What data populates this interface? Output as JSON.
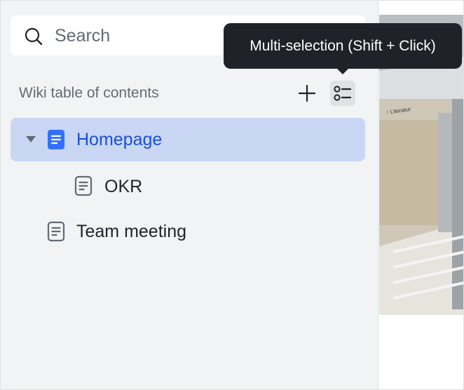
{
  "search": {
    "placeholder": "Search",
    "icon": "search-icon"
  },
  "toc": {
    "header": "Wiki table of contents",
    "add_icon": "plus-icon",
    "multi_select_icon": "multi-select-list-icon"
  },
  "tree": [
    {
      "label": "Homepage",
      "icon": "doc-icon",
      "selected": true,
      "expanded": true,
      "level": 0
    },
    {
      "label": "OKR",
      "icon": "doc-icon",
      "selected": false,
      "level": 1
    },
    {
      "label": "Team meeting",
      "icon": "doc-icon",
      "selected": false,
      "level": 0
    }
  ],
  "tooltip": {
    "text": "Multi-selection (Shift + Click)"
  },
  "preview": {
    "visible_text": "↑ Literatur"
  },
  "colors": {
    "sidebar_bg": "#f2f3f5",
    "selected_row_bg": "#c9d7f5",
    "selected_text": "#1d4ed8",
    "accent_icon": "#3370ff",
    "tooltip_bg": "#1f2329",
    "text_primary": "#1f2329",
    "text_secondary": "#646a73"
  }
}
